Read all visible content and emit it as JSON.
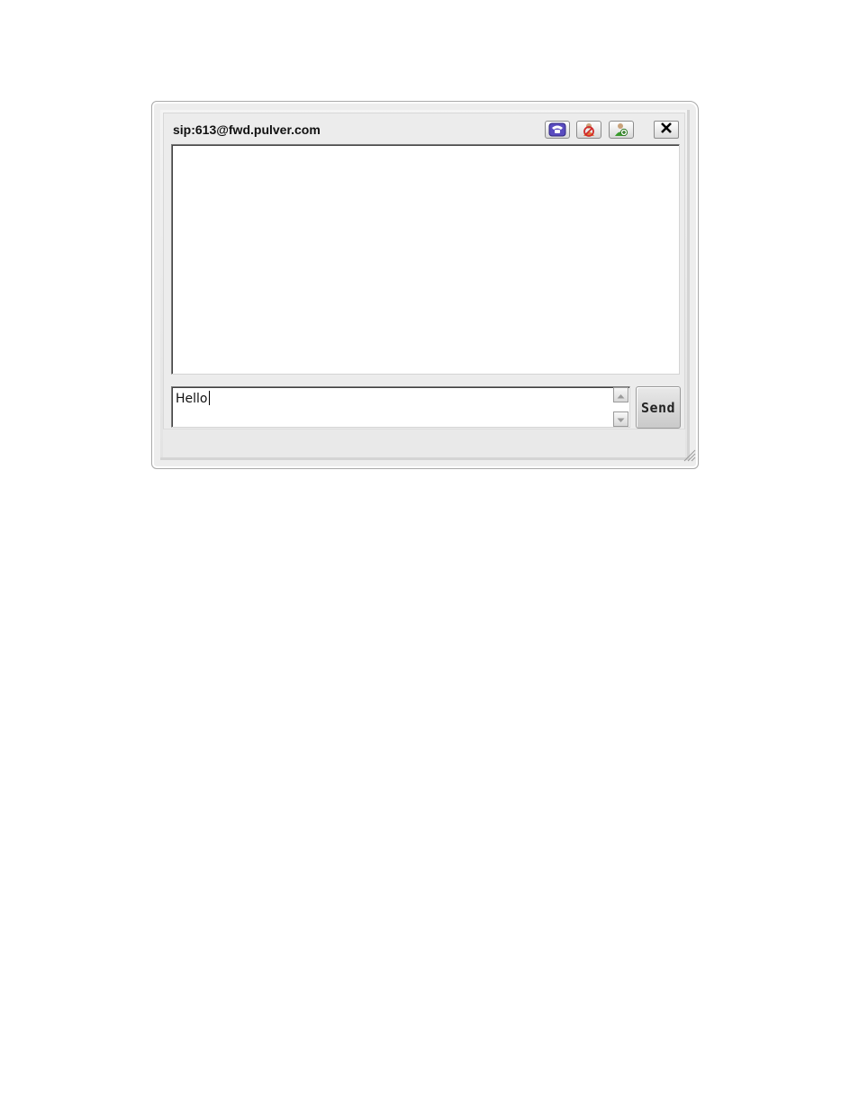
{
  "window": {
    "title": "sip:613@fwd.pulver.com",
    "toolbar": [
      {
        "icon": "phone-icon",
        "tooltip": "",
        "color": "#4b3fa5"
      },
      {
        "icon": "block-user-icon",
        "tooltip": "",
        "color": "#d12a2a"
      },
      {
        "icon": "add-contact-icon",
        "tooltip": "",
        "color": "#3a9a2d"
      }
    ],
    "close_icon": "close-icon"
  },
  "chat": {
    "messages": []
  },
  "input": {
    "value": "Hello"
  },
  "send": {
    "label": "Send"
  }
}
